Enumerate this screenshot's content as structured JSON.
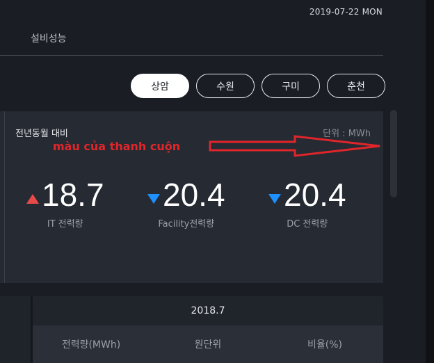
{
  "header": {
    "date": "2019-07-22 MON"
  },
  "tabs": {
    "performance": "설비성능"
  },
  "regions": [
    "상암",
    "수원",
    "구미",
    "춘천"
  ],
  "card": {
    "title": "전년동월 대비",
    "unit": "단위 : MWh",
    "annotation": "màu của thanh cuộn",
    "metrics": [
      {
        "value": "18.7",
        "label": "IT 전력량",
        "trend": "up",
        "color": "#e84a4a"
      },
      {
        "value": "20.4",
        "label": "Facility전력량",
        "trend": "down",
        "color": "#1e90ff"
      },
      {
        "value": "20.4",
        "label": "DC 전력량",
        "trend": "down",
        "color": "#1e90ff"
      }
    ]
  },
  "table": {
    "period": "2018.7",
    "columns": [
      "전력량(MWh)",
      "원단위",
      "비율(%)"
    ]
  }
}
